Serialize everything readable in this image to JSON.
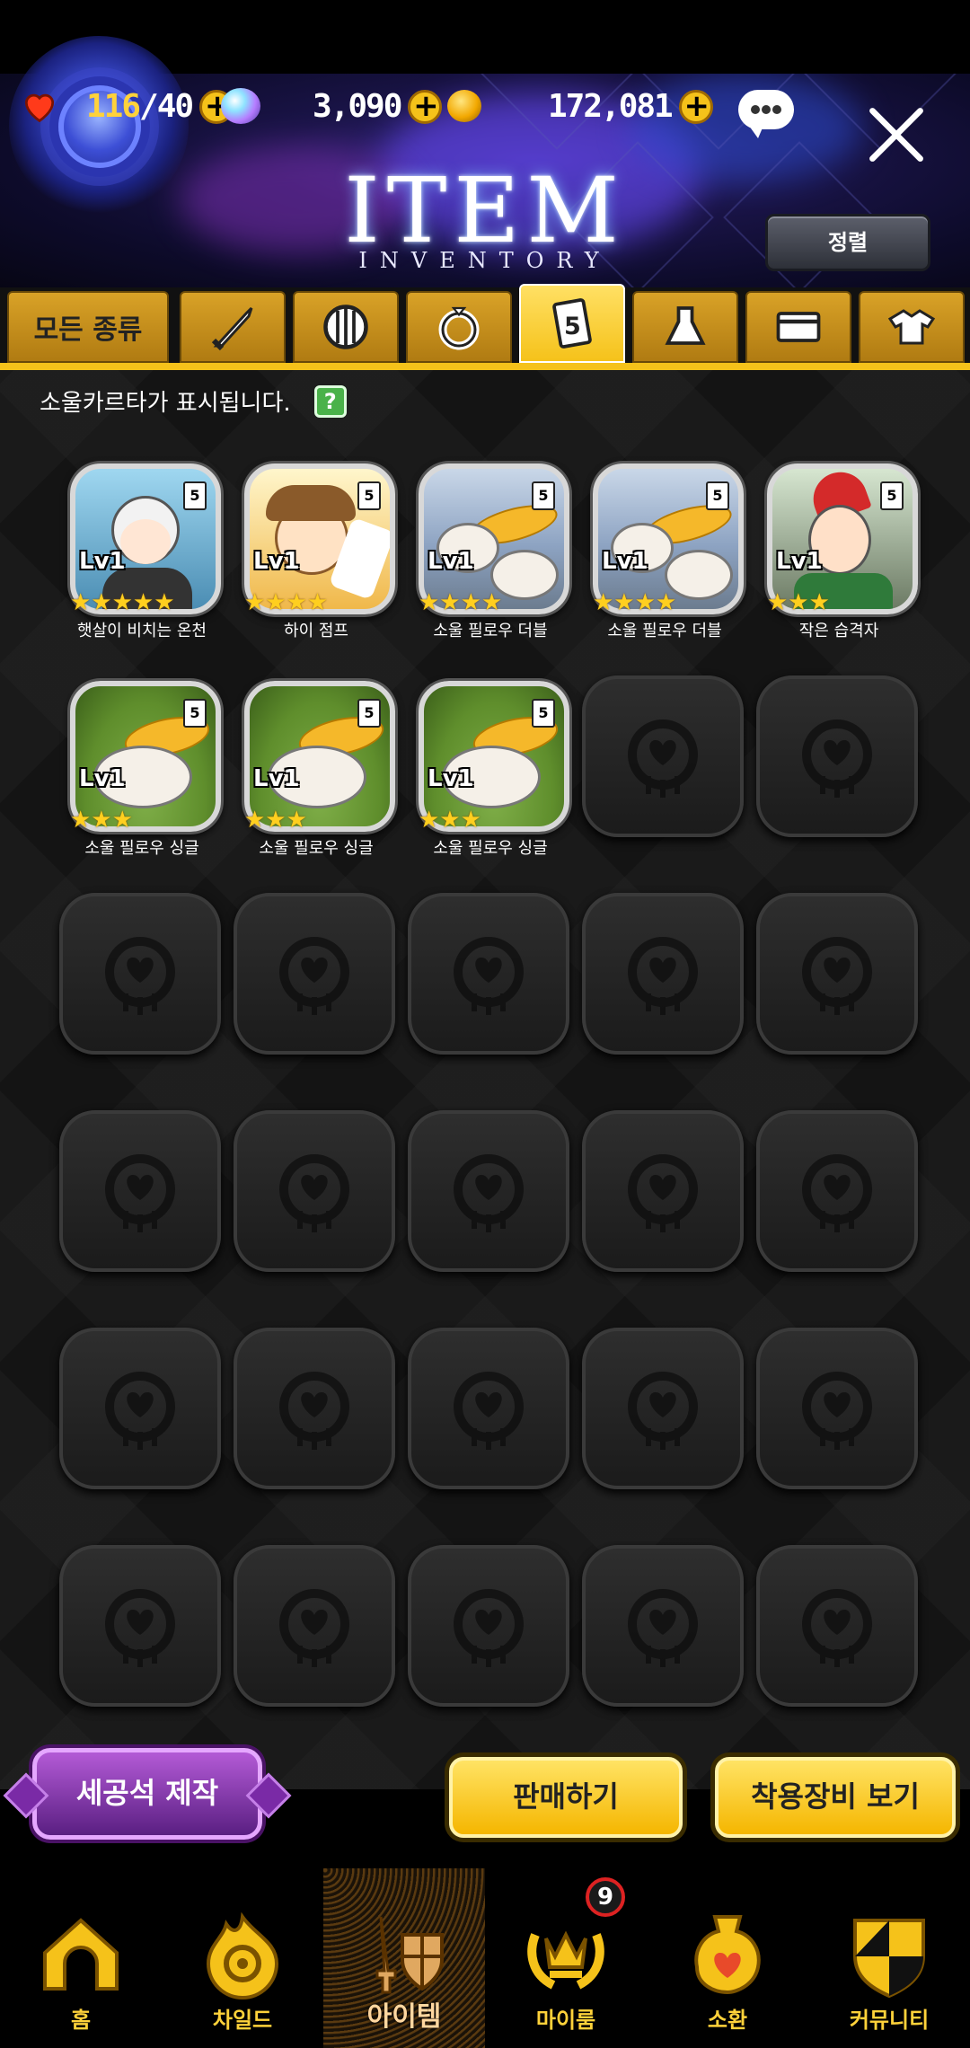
{
  "header": {
    "hearts": "116",
    "hearts_max": "/40",
    "gems": "3,090",
    "gold": "172,081",
    "title": "ITEM",
    "subtitle": "INVENTORY",
    "sort_label": "정렬"
  },
  "tabs": [
    {
      "label": "모든 종류",
      "icon": "all",
      "active": false
    },
    {
      "icon": "sword-icon",
      "active": false
    },
    {
      "icon": "shield-icon",
      "active": false
    },
    {
      "icon": "ring-icon",
      "active": false
    },
    {
      "icon": "soul-card-icon",
      "label": "5",
      "active": true
    },
    {
      "icon": "flask-icon",
      "active": false
    },
    {
      "icon": "card-icon",
      "active": false
    },
    {
      "icon": "costume-icon",
      "active": false
    }
  ],
  "notice": "소울카르타가 표시됩니다.",
  "help": "?",
  "items": [
    {
      "name": "햇살이 비치는 온천",
      "level": "Lv1",
      "stars": "★★★★★",
      "badge": "5"
    },
    {
      "name": "하이 점프",
      "level": "Lv1",
      "stars": "★★★★",
      "badge": "5"
    },
    {
      "name": "소울 필로우 더블",
      "level": "Lv1",
      "stars": "★★★★",
      "badge": "5"
    },
    {
      "name": "소울 필로우 더블",
      "level": "Lv1",
      "stars": "★★★★",
      "badge": "5"
    },
    {
      "name": "작은 습격자",
      "level": "Lv1",
      "stars": "★★★",
      "badge": "5"
    },
    {
      "name": "소울 필로우 싱글",
      "level": "Lv1",
      "stars": "★★★",
      "badge": "5"
    },
    {
      "name": "소울 필로우 싱글",
      "level": "Lv1",
      "stars": "★★★",
      "badge": "5"
    },
    {
      "name": "소울 필로우 싱글",
      "level": "Lv1",
      "stars": "★★★",
      "badge": "5"
    }
  ],
  "actions": {
    "craft": "세공석 제작",
    "sell": "판매하기",
    "view_equipped": "착용장비 보기"
  },
  "nav": [
    {
      "label": "홈",
      "icon": "home-icon"
    },
    {
      "label": "차일드",
      "icon": "child-icon"
    },
    {
      "label": "아이템",
      "icon": "item-icon",
      "active": true
    },
    {
      "label": "마이룸",
      "icon": "myroom-icon",
      "badge": "9"
    },
    {
      "label": "소환",
      "icon": "summon-icon"
    },
    {
      "label": "커뮤니티",
      "icon": "community-icon"
    }
  ],
  "colors": {
    "accent": "#f5c21a",
    "purple": "#8a3ab8",
    "background": "#141414"
  }
}
